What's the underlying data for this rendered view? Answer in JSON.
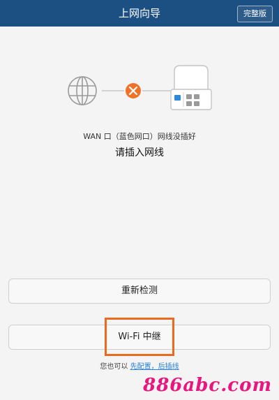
{
  "header": {
    "title": "上网向导",
    "full_version_label": "完整版"
  },
  "diagram": {
    "internet_icon": "globe-icon",
    "status_icon": "close-icon",
    "device_icon": "router-icon",
    "status_color": "#f07128"
  },
  "status": {
    "wan_message": "WAN 口（蓝色网口）网线没插好",
    "prompt": "请插入网线"
  },
  "buttons": {
    "retest_label": "重新检测",
    "wifi_relay_label": "Wi-Fi 中继"
  },
  "alt_setup": {
    "prefix": "您也可以",
    "link_text": "先配置，后插线"
  },
  "watermark": "886abc.com",
  "colors": {
    "header_bg": "#1c4f82",
    "highlight": "#ea6a1e",
    "link": "#2a7fd4"
  }
}
